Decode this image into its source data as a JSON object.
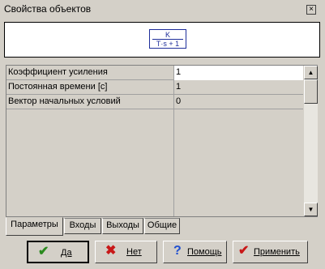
{
  "window": {
    "title": "Свойства объектов",
    "close_symbol": "×"
  },
  "preview": {
    "numerator": "K",
    "denominator": "T·s + 1"
  },
  "properties": [
    {
      "label": "Коэффициент усиления",
      "value": "1"
    },
    {
      "label": "Постоянная времени [с]",
      "value": "1"
    },
    {
      "label": "Вектор начальных условий",
      "value": "0"
    }
  ],
  "tabs": [
    "Параметры",
    "Входы",
    "Выходы",
    "Общие"
  ],
  "buttons": {
    "ok": "Да",
    "cancel": "Нет",
    "help": "Помощь",
    "apply": "Применить"
  },
  "icons": {
    "ok": "check-icon",
    "cancel": "x-icon",
    "help": "question-icon",
    "apply": "check-icon"
  }
}
